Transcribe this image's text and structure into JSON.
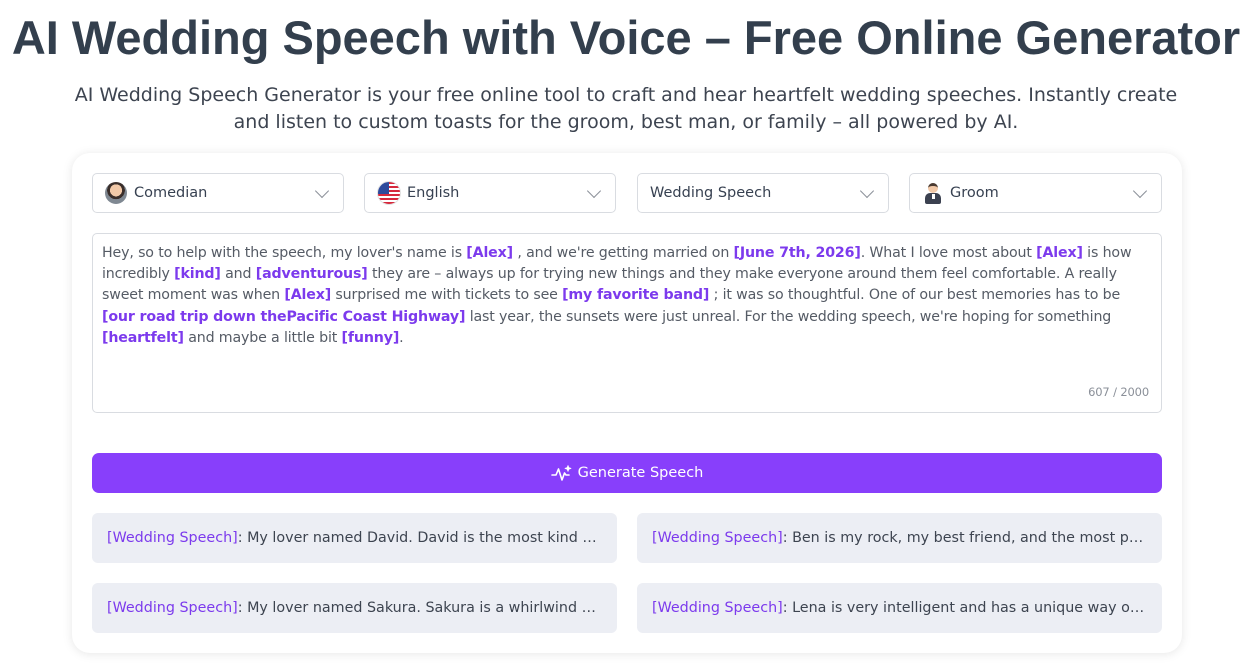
{
  "header": {
    "title": "AI Wedding Speech with Voice – Free Online Generator",
    "subtitle": "AI Wedding Speech Generator is your free online tool to craft and hear heartfelt wedding speeches. Instantly create and listen to custom toasts for the groom, best man, or family – all powered by AI."
  },
  "controls": {
    "voice": {
      "value": "Comedian",
      "icon": "comedian-avatar-icon"
    },
    "language": {
      "value": "English",
      "icon": "us-flag-icon"
    },
    "speech_type": {
      "value": "Wedding Speech"
    },
    "role": {
      "value": "Groom",
      "icon": "groom-icon"
    }
  },
  "prompt": {
    "segments": [
      {
        "text": "Hey, so to help with the speech, my lover's name is ",
        "highlight": false
      },
      {
        "text": "[Alex]",
        "highlight": true
      },
      {
        "text": " , and we're getting married on ",
        "highlight": false
      },
      {
        "text": "[June 7th, 2026]",
        "highlight": true
      },
      {
        "text": ". What I love most about ",
        "highlight": false
      },
      {
        "text": "[Alex]",
        "highlight": true
      },
      {
        "text": " is how incredibly ",
        "highlight": false
      },
      {
        "text": "[kind]",
        "highlight": true
      },
      {
        "text": " and ",
        "highlight": false
      },
      {
        "text": "[adventurous]",
        "highlight": true
      },
      {
        "text": " they are – always up for trying new things and they make everyone around them feel comfortable. A really sweet moment was when ",
        "highlight": false
      },
      {
        "text": "[Alex]",
        "highlight": true
      },
      {
        "text": " surprised me with tickets to see ",
        "highlight": false
      },
      {
        "text": "[my favorite band]",
        "highlight": true
      },
      {
        "text": " ; it was so thoughtful. One of our best memories has to be ",
        "highlight": false
      },
      {
        "text": "[our road trip down thePacific Coast Highway]",
        "highlight": true
      },
      {
        "text": " last year, the sunsets were just unreal. For the wedding speech, we're hoping for something ",
        "highlight": false
      },
      {
        "text": "[heartfelt]",
        "highlight": true
      },
      {
        "text": " and maybe a little bit ",
        "highlight": false
      },
      {
        "text": "[funny]",
        "highlight": true
      },
      {
        "text": ".",
        "highlight": false
      }
    ],
    "counter": "607 / 2000"
  },
  "generate_button": {
    "label": "Generate Speech",
    "icon": "sparkle-wave-icon"
  },
  "examples": [
    {
      "tag": "[Wedding Speech]",
      "text": ": My lover named David. David is the most kind and steady person I know, always there for me and making every day feel brighter."
    },
    {
      "tag": "[Wedding Speech]",
      "text": ": Ben is my rock, my best friend, and the most passionate person I have ever met in my whole life."
    },
    {
      "tag": "[Wedding Speech]",
      "text": ": My lover named Sakura. Sakura is a whirlwind of energy and joy, and she fills every room with laughter."
    },
    {
      "tag": "[Wedding Speech]",
      "text": ": Lena is very intelligent and has a unique way of looking at the world that always inspires me."
    }
  ],
  "colors": {
    "accent": "#883ffb",
    "highlight_text": "#7c3aed",
    "example_bg": "#eceef4",
    "title": "#333f4d"
  }
}
